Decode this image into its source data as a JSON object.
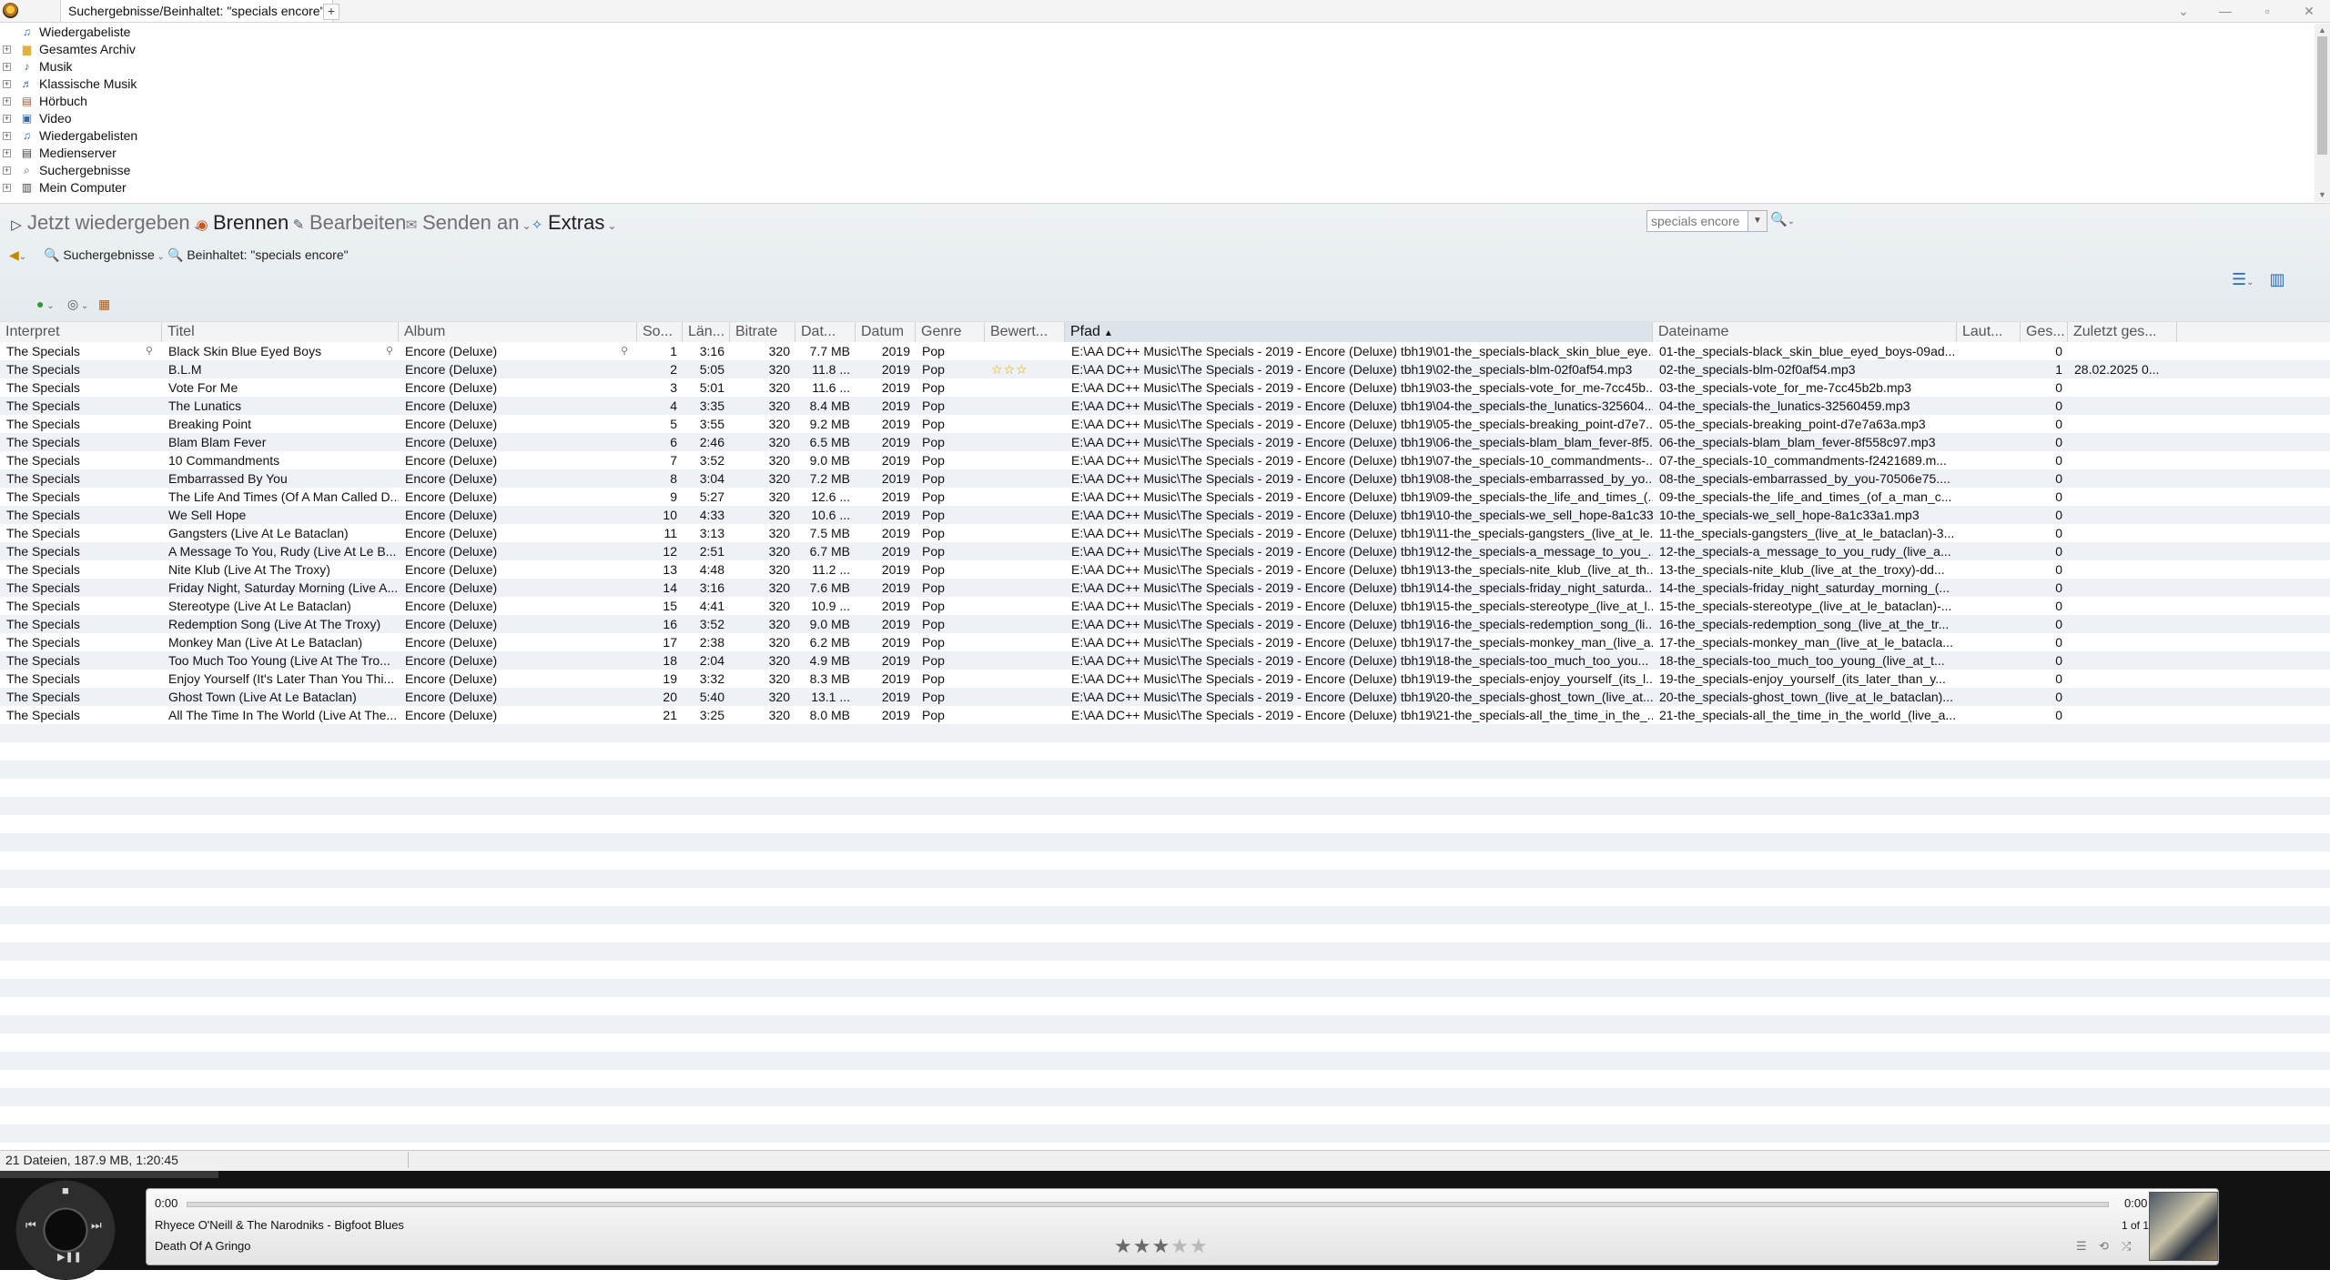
{
  "titlebar": {
    "tab_label": "Suchergebnisse/Beinhaltet: \"specials encore\"",
    "add_tab": "+",
    "controls": [
      "⌄",
      "—",
      "▫",
      "✕"
    ]
  },
  "tree": {
    "items": [
      {
        "label": "Wiedergabeliste",
        "icon": "playlist-icon",
        "expander": false
      },
      {
        "label": "Gesamtes Archiv",
        "icon": "folder-icon",
        "expander": true
      },
      {
        "label": "Musik",
        "icon": "music-note-icon",
        "expander": true
      },
      {
        "label": "Klassische Musik",
        "icon": "classical-music-icon",
        "expander": true
      },
      {
        "label": "Hörbuch",
        "icon": "audiobook-icon",
        "expander": true
      },
      {
        "label": "Video",
        "icon": "video-icon",
        "expander": true
      },
      {
        "label": "Wiedergabelisten",
        "icon": "playlists-icon",
        "expander": true
      },
      {
        "label": "Medienserver",
        "icon": "media-server-icon",
        "expander": true
      },
      {
        "label": "Suchergebnisse",
        "icon": "search-results-icon",
        "expander": true
      },
      {
        "label": "Mein Computer",
        "icon": "computer-icon",
        "expander": true
      }
    ]
  },
  "toolbar": {
    "now_playing": "Jetzt wiedergeben",
    "burn": "Brennen",
    "edit": "Bearbeiten",
    "send_to": "Senden an",
    "extras": "Extras"
  },
  "search": {
    "value": "specials encore"
  },
  "breadcrumb": {
    "search_results": "Suchergebnisse",
    "contains": "Beinhaltet: \"specials encore\""
  },
  "grid": {
    "columns": [
      "Interpret",
      "Titel",
      "Album",
      "So...",
      "Län...",
      "Bitrate",
      "Dat...",
      "Datum",
      "Genre",
      "Bewert...",
      "Pfad",
      "Dateiname",
      "Laut...",
      "Ges...",
      "Zuletzt ges..."
    ],
    "sort_indicator": "▲",
    "rows": [
      [
        "The Specials",
        "Black Skin Blue Eyed Boys",
        "Encore (Deluxe)",
        "1",
        "3:16",
        "320",
        "7.7 MB",
        "2019",
        "Pop",
        "",
        "E:\\AA DC++ Music\\The Specials - 2019 - Encore (Deluxe) tbh19\\01-the_specials-black_skin_blue_eye...",
        "01-the_specials-black_skin_blue_eyed_boys-09ad...",
        "",
        "0",
        ""
      ],
      [
        "The Specials",
        "B.L.M",
        "Encore (Deluxe)",
        "2",
        "5:05",
        "320",
        "11.8 ...",
        "2019",
        "Pop",
        "☆☆☆",
        "E:\\AA DC++ Music\\The Specials - 2019 - Encore (Deluxe) tbh19\\02-the_specials-blm-02f0af54.mp3",
        "02-the_specials-blm-02f0af54.mp3",
        "",
        "1",
        "28.02.2025 0..."
      ],
      [
        "The Specials",
        "Vote For Me",
        "Encore (Deluxe)",
        "3",
        "5:01",
        "320",
        "11.6 ...",
        "2019",
        "Pop",
        "",
        "E:\\AA DC++ Music\\The Specials - 2019 - Encore (Deluxe) tbh19\\03-the_specials-vote_for_me-7cc45b...",
        "03-the_specials-vote_for_me-7cc45b2b.mp3",
        "",
        "0",
        ""
      ],
      [
        "The Specials",
        "The Lunatics",
        "Encore (Deluxe)",
        "4",
        "3:35",
        "320",
        "8.4 MB",
        "2019",
        "Pop",
        "",
        "E:\\AA DC++ Music\\The Specials - 2019 - Encore (Deluxe) tbh19\\04-the_specials-the_lunatics-325604...",
        "04-the_specials-the_lunatics-32560459.mp3",
        "",
        "0",
        ""
      ],
      [
        "The Specials",
        "Breaking Point",
        "Encore (Deluxe)",
        "5",
        "3:55",
        "320",
        "9.2 MB",
        "2019",
        "Pop",
        "",
        "E:\\AA DC++ Music\\The Specials - 2019 - Encore (Deluxe) tbh19\\05-the_specials-breaking_point-d7e7...",
        "05-the_specials-breaking_point-d7e7a63a.mp3",
        "",
        "0",
        ""
      ],
      [
        "The Specials",
        "Blam Blam Fever",
        "Encore (Deluxe)",
        "6",
        "2:46",
        "320",
        "6.5 MB",
        "2019",
        "Pop",
        "",
        "E:\\AA DC++ Music\\The Specials - 2019 - Encore (Deluxe) tbh19\\06-the_specials-blam_blam_fever-8f5...",
        "06-the_specials-blam_blam_fever-8f558c97.mp3",
        "",
        "0",
        ""
      ],
      [
        "The Specials",
        "10 Commandments",
        "Encore (Deluxe)",
        "7",
        "3:52",
        "320",
        "9.0 MB",
        "2019",
        "Pop",
        "",
        "E:\\AA DC++ Music\\The Specials - 2019 - Encore (Deluxe) tbh19\\07-the_specials-10_commandments-...",
        "07-the_specials-10_commandments-f2421689.m...",
        "",
        "0",
        ""
      ],
      [
        "The Specials",
        "Embarrassed By You",
        "Encore (Deluxe)",
        "8",
        "3:04",
        "320",
        "7.2 MB",
        "2019",
        "Pop",
        "",
        "E:\\AA DC++ Music\\The Specials - 2019 - Encore (Deluxe) tbh19\\08-the_specials-embarrassed_by_yo...",
        "08-the_specials-embarrassed_by_you-70506e75....",
        "",
        "0",
        ""
      ],
      [
        "The Specials",
        "The Life And Times (Of A Man Called D...",
        "Encore (Deluxe)",
        "9",
        "5:27",
        "320",
        "12.6 ...",
        "2019",
        "Pop",
        "",
        "E:\\AA DC++ Music\\The Specials - 2019 - Encore (Deluxe) tbh19\\09-the_specials-the_life_and_times_(...",
        "09-the_specials-the_life_and_times_(of_a_man_c...",
        "",
        "0",
        ""
      ],
      [
        "The Specials",
        "We Sell Hope",
        "Encore (Deluxe)",
        "10",
        "4:33",
        "320",
        "10.6 ...",
        "2019",
        "Pop",
        "",
        "E:\\AA DC++ Music\\The Specials - 2019 - Encore (Deluxe) tbh19\\10-the_specials-we_sell_hope-8a1c33...",
        "10-the_specials-we_sell_hope-8a1c33a1.mp3",
        "",
        "0",
        ""
      ],
      [
        "The Specials",
        "Gangsters (Live At Le Bataclan)",
        "Encore (Deluxe)",
        "11",
        "3:13",
        "320",
        "7.5 MB",
        "2019",
        "Pop",
        "",
        "E:\\AA DC++ Music\\The Specials - 2019 - Encore (Deluxe) tbh19\\11-the_specials-gangsters_(live_at_le...",
        "11-the_specials-gangsters_(live_at_le_bataclan)-3...",
        "",
        "0",
        ""
      ],
      [
        "The Specials",
        "A Message To You, Rudy (Live At Le B...",
        "Encore (Deluxe)",
        "12",
        "2:51",
        "320",
        "6.7 MB",
        "2019",
        "Pop",
        "",
        "E:\\AA DC++ Music\\The Specials - 2019 - Encore (Deluxe) tbh19\\12-the_specials-a_message_to_you_...",
        "12-the_specials-a_message_to_you_rudy_(live_a...",
        "",
        "0",
        ""
      ],
      [
        "The Specials",
        "Nite Klub (Live At The Troxy)",
        "Encore (Deluxe)",
        "13",
        "4:48",
        "320",
        "11.2 ...",
        "2019",
        "Pop",
        "",
        "E:\\AA DC++ Music\\The Specials - 2019 - Encore (Deluxe) tbh19\\13-the_specials-nite_klub_(live_at_th...",
        "13-the_specials-nite_klub_(live_at_the_troxy)-dd...",
        "",
        "0",
        ""
      ],
      [
        "The Specials",
        "Friday Night, Saturday Morning (Live A...",
        "Encore (Deluxe)",
        "14",
        "3:16",
        "320",
        "7.6 MB",
        "2019",
        "Pop",
        "",
        "E:\\AA DC++ Music\\The Specials - 2019 - Encore (Deluxe) tbh19\\14-the_specials-friday_night_saturda...",
        "14-the_specials-friday_night_saturday_morning_(...",
        "",
        "0",
        ""
      ],
      [
        "The Specials",
        "Stereotype (Live At Le Bataclan)",
        "Encore (Deluxe)",
        "15",
        "4:41",
        "320",
        "10.9 ...",
        "2019",
        "Pop",
        "",
        "E:\\AA DC++ Music\\The Specials - 2019 - Encore (Deluxe) tbh19\\15-the_specials-stereotype_(live_at_l...",
        "15-the_specials-stereotype_(live_at_le_bataclan)-...",
        "",
        "0",
        ""
      ],
      [
        "The Specials",
        "Redemption Song (Live At The Troxy)",
        "Encore (Deluxe)",
        "16",
        "3:52",
        "320",
        "9.0 MB",
        "2019",
        "Pop",
        "",
        "E:\\AA DC++ Music\\The Specials - 2019 - Encore (Deluxe) tbh19\\16-the_specials-redemption_song_(li...",
        "16-the_specials-redemption_song_(live_at_the_tr...",
        "",
        "0",
        ""
      ],
      [
        "The Specials",
        "Monkey Man (Live At Le Bataclan)",
        "Encore (Deluxe)",
        "17",
        "2:38",
        "320",
        "6.2 MB",
        "2019",
        "Pop",
        "",
        "E:\\AA DC++ Music\\The Specials - 2019 - Encore (Deluxe) tbh19\\17-the_specials-monkey_man_(live_a...",
        "17-the_specials-monkey_man_(live_at_le_batacla...",
        "",
        "0",
        ""
      ],
      [
        "The Specials",
        "Too Much Too Young (Live At The Tro...",
        "Encore (Deluxe)",
        "18",
        "2:04",
        "320",
        "4.9 MB",
        "2019",
        "Pop",
        "",
        "E:\\AA DC++ Music\\The Specials - 2019 - Encore (Deluxe) tbh19\\18-the_specials-too_much_too_you...",
        "18-the_specials-too_much_too_young_(live_at_t...",
        "",
        "0",
        ""
      ],
      [
        "The Specials",
        "Enjoy Yourself (It's Later Than You Thi...",
        "Encore (Deluxe)",
        "19",
        "3:32",
        "320",
        "8.3 MB",
        "2019",
        "Pop",
        "",
        "E:\\AA DC++ Music\\The Specials - 2019 - Encore (Deluxe) tbh19\\19-the_specials-enjoy_yourself_(its_l...",
        "19-the_specials-enjoy_yourself_(its_later_than_y...",
        "",
        "0",
        ""
      ],
      [
        "The Specials",
        "Ghost Town (Live At Le Bataclan)",
        "Encore (Deluxe)",
        "20",
        "5:40",
        "320",
        "13.1 ...",
        "2019",
        "Pop",
        "",
        "E:\\AA DC++ Music\\The Specials - 2019 - Encore (Deluxe) tbh19\\20-the_specials-ghost_town_(live_at...",
        "20-the_specials-ghost_town_(live_at_le_bataclan)...",
        "",
        "0",
        ""
      ],
      [
        "The Specials",
        "All The Time In The World (Live At The...",
        "Encore (Deluxe)",
        "21",
        "3:25",
        "320",
        "8.0 MB",
        "2019",
        "Pop",
        "",
        "E:\\AA DC++ Music\\The Specials - 2019 - Encore (Deluxe) tbh19\\21-the_specials-all_the_time_in_the_...",
        "21-the_specials-all_the_time_in_the_world_(live_a...",
        "",
        "0",
        ""
      ]
    ]
  },
  "status": {
    "summary": "21 Dateien, 187.9 MB, 1:20:45"
  },
  "player": {
    "time_elapsed": "0:00",
    "time_total": "0:00",
    "track_line": "Rhyece O'Neill & The Narodniks - Bigfoot Blues",
    "album_line": "Death Of A Gringo",
    "counter": "1 of 1",
    "rating_stars": 3,
    "rating_max": 5
  },
  "colors": {
    "accent": "#2d6bb2",
    "star": "#d8a300"
  }
}
